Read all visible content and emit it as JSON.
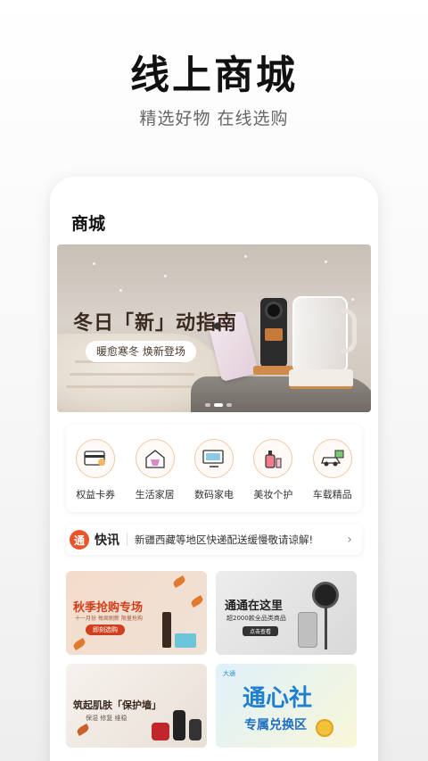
{
  "hero": {
    "title": "线上商城",
    "subtitle": "精选好物  在线选购"
  },
  "screen": {
    "title": "商城",
    "banner": {
      "headline": "冬日「新」动指南",
      "tagline": "暖愈寒冬 焕新登场",
      "page_count": 3,
      "active_page": 1
    },
    "categories": [
      {
        "label": "权益卡券",
        "icon": "card-voucher-icon"
      },
      {
        "label": "生活家居",
        "icon": "home-basket-icon"
      },
      {
        "label": "数码家电",
        "icon": "tv-appliance-icon"
      },
      {
        "label": "美妆个护",
        "icon": "cosmetics-icon"
      },
      {
        "label": "车载精品",
        "icon": "car-gift-icon"
      }
    ],
    "news": {
      "badge": "通",
      "tag": "快讯",
      "text": "新疆西藏等地区快递配送缓慢敬请谅解!"
    },
    "promos": [
      {
        "title": "秋季抢购专场",
        "subtitle": "十一月份 每周刷新 限量抢购",
        "button": "即刻选购"
      },
      {
        "title": "通通在这里",
        "subtitle": "超2000款全品类商品",
        "button": "点击查看"
      },
      {
        "title": "筑起肌肤「保护墙」",
        "subtitle": "保湿 修复 维稳"
      },
      {
        "logo": "大通",
        "title": "通心社",
        "subtitle": "专属兑换区"
      }
    ]
  },
  "colors": {
    "accent": "#e8552b",
    "promo_blue": "#1f7fd0"
  }
}
